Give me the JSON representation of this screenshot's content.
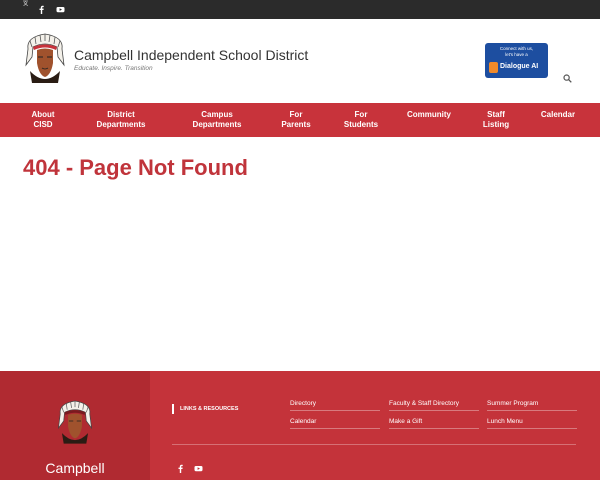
{
  "topbar": {
    "icons": [
      "translate-icon",
      "facebook-icon",
      "youtube-icon"
    ]
  },
  "header": {
    "site_name": "Campbell Independent School District",
    "tagline": "Educate. Inspire. Transition",
    "dialogue_ad": {
      "line1": "Connect with us,",
      "line2": "let's have a",
      "label": "Dialogue AI"
    }
  },
  "nav": {
    "items": [
      {
        "line1": "About",
        "line2": "CISD"
      },
      {
        "line1": "District",
        "line2": "Departments"
      },
      {
        "line1": "Campus",
        "line2": "Departments"
      },
      {
        "line1": "For",
        "line2": "Parents"
      },
      {
        "line1": "For",
        "line2": "Students"
      },
      {
        "line1": "Community",
        "line2": ""
      },
      {
        "line1": "Staff",
        "line2": "Listing"
      },
      {
        "line1": "Calendar",
        "line2": ""
      }
    ]
  },
  "main": {
    "title": "404 - Page Not Found"
  },
  "footer": {
    "name": "Campbell",
    "links_heading": "LINKS & RESOURCES",
    "links": [
      "Directory",
      "Faculty & Staff Directory",
      "Summer Program",
      "Calendar",
      "Make a Gift",
      "Lunch Menu"
    ]
  },
  "colors": {
    "brand_red": "#c8333b",
    "footer_dark": "#b02a31",
    "topbar": "#2b2b2b",
    "dialogue_blue": "#1d4ea0"
  }
}
